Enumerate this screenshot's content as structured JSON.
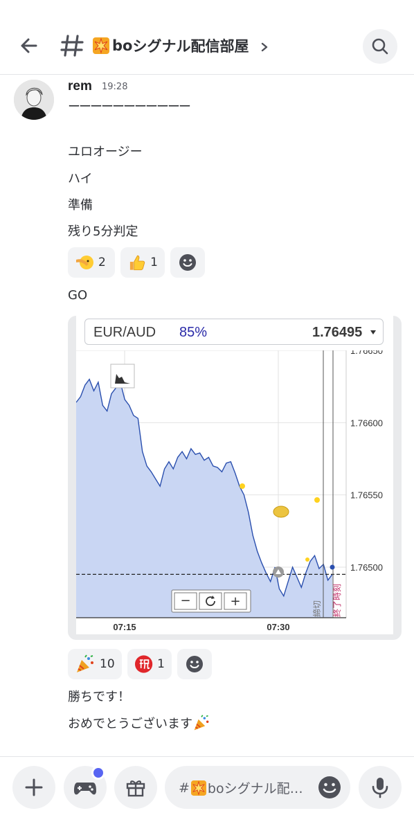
{
  "header": {
    "channel_prefix": "bo",
    "channel_name": "シグナル配信部屋"
  },
  "message": {
    "author": "rem",
    "time": "19:28",
    "lines": [
      "ーーーーーーーーーーー",
      "ユロオージー",
      "ハイ",
      "準備",
      "残り5分判定"
    ],
    "reactions": [
      {
        "emoji": "face-palm-emoji",
        "count": "2"
      },
      {
        "emoji": "thumbs-up-emoji",
        "count": "1"
      }
    ],
    "go_text": "GO",
    "reactions2": [
      {
        "emoji": "party-popper-emoji",
        "count": "10"
      },
      {
        "emoji": "congratulations-emoji",
        "count": "1"
      }
    ],
    "after_lines": [
      "勝ちです！",
      "おめでとうございます"
    ]
  },
  "embed": {
    "pair": "EUR/AUD",
    "payout": "85%",
    "price": "1.76495",
    "chart_data": {
      "type": "area",
      "title": "",
      "x_tick_labels": [
        "07:15",
        "07:30"
      ],
      "y_tick_labels": [
        "1.76650",
        "1.76600",
        "1.76550",
        "1.76500"
      ],
      "ylim": [
        1.76465,
        1.7665
      ],
      "entry_level": 1.76495,
      "vertical_labels": [
        "締切",
        "終了時刻"
      ],
      "series": [
        {
          "values": [
            1.76614,
            1.76618,
            1.76626,
            1.7663,
            1.76622,
            1.76628,
            1.76612,
            1.76608,
            1.7662,
            1.76624,
            1.76628,
            1.76616,
            1.76612,
            1.76605,
            1.76603,
            1.7658,
            1.7657,
            1.76566,
            1.76561,
            1.76556,
            1.76568,
            1.76573,
            1.76568,
            1.76576,
            1.7658,
            1.76575,
            1.76582,
            1.76578,
            1.76579,
            1.76574,
            1.76576,
            1.7657,
            1.76569,
            1.76566,
            1.76572,
            1.76573,
            1.76565,
            1.76556,
            1.7655,
            1.76538,
            1.76522,
            1.76511,
            1.76503,
            1.76496,
            1.7649,
            1.765,
            1.76485,
            1.7648,
            1.7649,
            1.765,
            1.76493,
            1.76486,
            1.76496,
            1.76504,
            1.76508,
            1.76499,
            1.76502,
            1.76491,
            1.76495
          ]
        }
      ]
    },
    "controls": {
      "minus": "−",
      "plus": "+"
    }
  },
  "composer": {
    "placeholder_prefix": "#",
    "placeholder_channel": "boシグナル配…"
  }
}
